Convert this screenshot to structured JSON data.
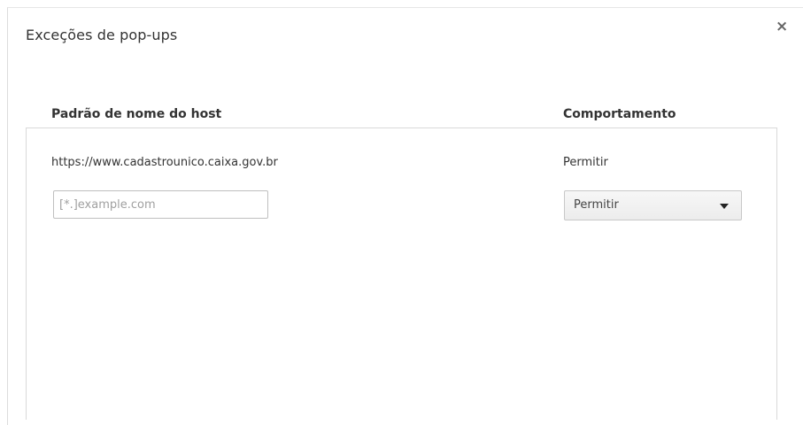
{
  "dialog": {
    "title": "Exceções de pop-ups",
    "close_label": "×"
  },
  "table": {
    "headers": {
      "host": "Padrão de nome do host",
      "behavior": "Comportamento"
    },
    "rows": [
      {
        "host": "https://www.cadastrounico.caixa.gov.br",
        "behavior": "Permitir"
      }
    ],
    "new_entry": {
      "host_placeholder": "[*.]example.com",
      "host_value": "",
      "behavior_selected": "Permitir"
    }
  },
  "icons": {
    "close": "close-icon",
    "dropdown": "chevron-down-icon"
  }
}
